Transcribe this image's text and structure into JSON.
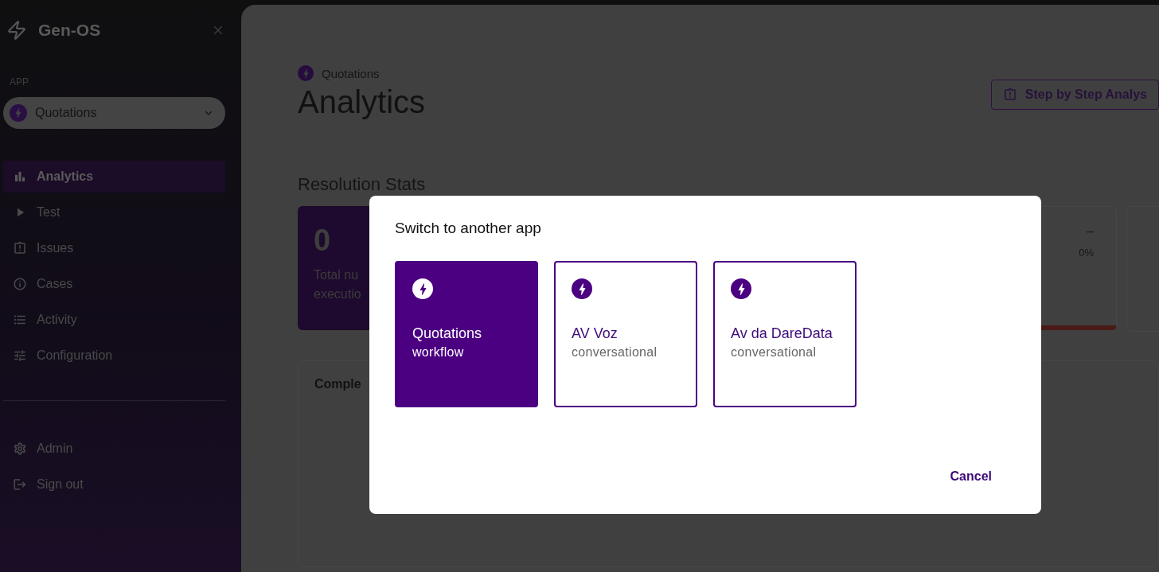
{
  "sidebar": {
    "brand": "Gen-OS",
    "app_label": "APP",
    "app_select": {
      "value": "Quotations"
    },
    "nav": [
      {
        "kind": "analytics",
        "label": "Analytics",
        "selected": true
      },
      {
        "kind": "test",
        "label": "Test",
        "selected": false
      },
      {
        "kind": "issues",
        "label": "Issues",
        "selected": false
      },
      {
        "kind": "cases",
        "label": "Cases",
        "selected": false
      },
      {
        "kind": "activity",
        "label": "Activity",
        "selected": false
      },
      {
        "kind": "configuration",
        "label": "Configuration",
        "selected": false
      }
    ],
    "footer": [
      {
        "kind": "admin",
        "label": "Admin"
      },
      {
        "kind": "signout",
        "label": "Sign out"
      }
    ]
  },
  "main": {
    "breadcrumb": "Quotations",
    "title": "Analytics",
    "action_button": "Step by Step Analys",
    "section_title": "Resolution Stats",
    "stat_card": {
      "value": "0",
      "caption_lines": [
        "Total nu",
        "executio"
      ]
    },
    "side_stat": {
      "value": "–",
      "percent": "0%"
    },
    "chart_card_title": "Comple"
  },
  "modal": {
    "title": "Switch to another app",
    "apps": [
      {
        "name": "Quotations",
        "type": "workflow",
        "selected": true
      },
      {
        "name": "AV Voz",
        "type": "conversational",
        "selected": false
      },
      {
        "name": "Av da DareData",
        "type": "conversational",
        "selected": false
      }
    ],
    "cancel": "Cancel"
  }
}
